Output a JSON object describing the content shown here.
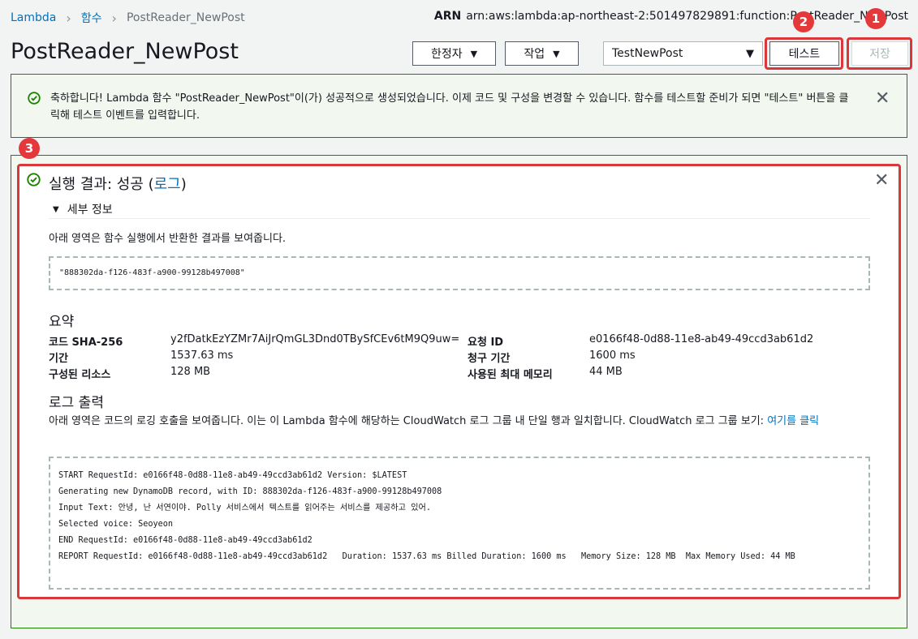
{
  "breadcrumb": {
    "root": "Lambda",
    "functions": "함수",
    "current": "PostReader_NewPost"
  },
  "arn": {
    "label": "ARN",
    "value": "arn:aws:lambda:ap-northeast-2:501497829891:function:PostReader_NewPost"
  },
  "page_title": "PostReader_NewPost",
  "toolbar": {
    "qualifier_label": "한정자",
    "actions_label": "작업",
    "test_event_value": "TestNewPost",
    "test_label": "테스트",
    "save_label": "저장"
  },
  "annotations": {
    "badge1": "1",
    "badge2": "2",
    "badge3": "3",
    "highlight_color": "#d9373a"
  },
  "flash": {
    "message": "축하합니다! Lambda 함수 \"PostReader_NewPost\"이(가) 성공적으로 생성되었습니다. 이제 코드 및 구성을 변경할 수 있습니다. 함수를 테스트할 준비가 되면 \"테스트\" 버튼을 클릭해 테스트 이벤트를 입력합니다."
  },
  "result": {
    "title_prefix": "실행 결과: 성공 (",
    "log_link": "로그",
    "title_suffix": ")",
    "details_label": "세부 정보",
    "return_desc": "아래 영역은 함수 실행에서 반환한 결과를 보여줍니다.",
    "return_value": "\"888302da-f126-483f-a900-99128b497008\"",
    "summary_title": "요약",
    "summary": {
      "code_sha_label": "코드 SHA-256",
      "code_sha_value": "y2fDatkEzYZMr7AiJrQmGL3Dnd0TBySfCEv6tM9Q9uw=",
      "request_id_label": "요청 ID",
      "request_id_value": "e0166f48-0d88-11e8-ab49-49ccd3ab61d2",
      "duration_label": "기간",
      "duration_value": "1537.63 ms",
      "billed_label": "청구 기간",
      "billed_value": "1600 ms",
      "resources_label": "구성된 리소스",
      "resources_value": "128 MB",
      "max_mem_label": "사용된 최대 메모리",
      "max_mem_value": "44 MB"
    },
    "log_title": "로그 출력",
    "log_desc": "아래 영역은 코드의 로깅 호출을 보여줍니다. 이는 이 Lambda 함수에 해당하는 CloudWatch 로그 그룹 내 단일 행과 일치합니다. CloudWatch 로그 그룹 보기: ",
    "log_desc_link": "여기를 클릭",
    "log_lines": [
      "START RequestId: e0166f48-0d88-11e8-ab49-49ccd3ab61d2 Version: $LATEST",
      "Generating new DynamoDB record, with ID: 888302da-f126-483f-a900-99128b497008",
      "Input Text: 안녕, 난 서연이야. Polly 서비스에서 텍스트를 읽어주는 서비스를 제공하고 있어.",
      "Selected voice: Seoyeon",
      "END RequestId: e0166f48-0d88-11e8-ab49-49ccd3ab61d2",
      "REPORT RequestId: e0166f48-0d88-11e8-ab49-49ccd3ab61d2\tDuration: 1537.63 ms\tBilled Duration: 1600 ms \tMemory Size: 128 MB\tMax Memory Used: 44 MB"
    ]
  }
}
